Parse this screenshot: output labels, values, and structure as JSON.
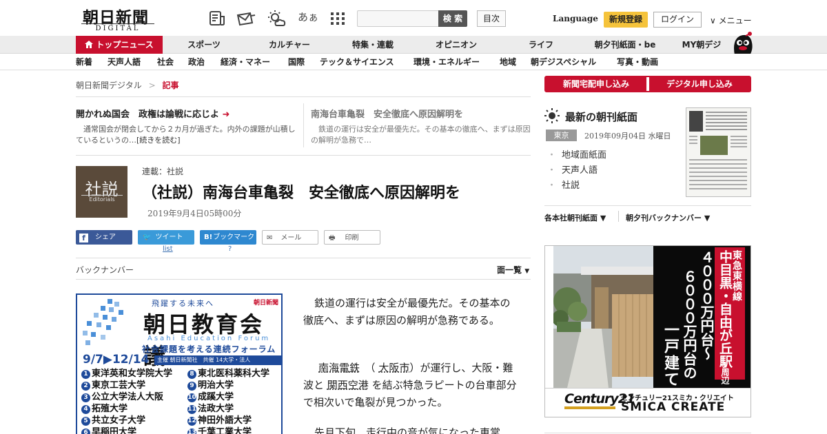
{
  "header": {
    "logo_main": "朝日新聞",
    "logo_sub": "DIGITAL",
    "icon_kana": "あぁ",
    "search_button": "検 索",
    "toc_button": "目次",
    "language": "Language",
    "signup": "新規登録",
    "login": "ログイン",
    "menu": "∨ メニュー"
  },
  "nav1": [
    "トップニュース",
    "スポーツ",
    "カルチャー",
    "特集・連載",
    "オピニオン",
    "ライフ",
    "朝夕刊紙面・be",
    "MY朝デジ"
  ],
  "nav2": [
    "新着",
    "天声人語",
    "社会",
    "政治",
    "経済・マネー",
    "国際",
    "テック＆サイエンス",
    "環境・エネルギー",
    "地域",
    "朝デジスペシャル",
    "写真・動画"
  ],
  "breadcrumb": {
    "home": "朝日新聞デジタル",
    "sep": ">",
    "current": "記事"
  },
  "related": [
    {
      "title": "開かれぬ国会　政権は論戦に応じよ",
      "body": "通常国会が閉会してから２カ月が過ぎた。内外の課題が山積しているというの…",
      "more": "[続きを読む]"
    },
    {
      "title": "南海台車亀裂　安全徹底へ原因解明を",
      "body": "鉄道の運行は安全が最優先だ。その基本の徹底へ、まずは原因の解明が急務で…"
    }
  ],
  "article": {
    "badge_main": "社説",
    "badge_sub": "Editorials",
    "series": "連載：社説",
    "title": "（社説）南海台車亀裂　安全徹底へ原因解明を",
    "date": "2019年9月4日05時00分",
    "share": {
      "facebook": "シェア",
      "tweet": "ツイート",
      "tweet_sub": "list",
      "hatena": "ブックマーク",
      "hatena_sub": "?",
      "mail": "メール",
      "print": "印刷"
    },
    "backnumber": "バックナンバー",
    "ichiran": "面一覧",
    "p1": "鉄道の運行は安全が最優先だ。その基本の徹底へ、まずは原因の解明が急務である。",
    "p2_a": "南海電鉄",
    "p2_b": "（",
    "p2_c": "大阪市",
    "p2_d": "）が運行し、大阪・難波と",
    "p2_e": "関西空港",
    "p2_f": "を結ぶ特急ラピートの台車部分で相次いで亀裂が見つかった。",
    "p3": "先月下旬、走行中の音が気になった車掌"
  },
  "ad_left": {
    "top": "飛躍する未来へ",
    "brand": "朝日新聞",
    "title": "朝日教育会議",
    "en": "Asahi Education Forum",
    "subtitle": "社会課題を考える連続フォーラム",
    "dates": "9/7▶12/14",
    "host": "主催 朝日新聞社　共催 14大学・法人",
    "left": [
      "東洋英和女学院大学",
      "東京工芸大学",
      "公立大学法人大阪",
      "拓殖大学",
      "共立女子大学",
      "早稲田大学"
    ],
    "left_nums": [
      "1",
      "2",
      "3",
      "4",
      "5",
      "6"
    ],
    "right": [
      "東北医科薬科大学",
      "明治大学",
      "成蹊大学",
      "法政大学",
      "神田外語大学",
      "千葉工業大学"
    ],
    "right_nums": [
      "8",
      "9",
      "10",
      "11",
      "12",
      "13"
    ]
  },
  "right": {
    "btn_delivery": "新聞宅配申し込み",
    "btn_digital": "デジタル申し込み",
    "chokan_title": "最新の朝刊紙面",
    "region": "東京",
    "paper_date": "2019年09月04日 水曜日",
    "list": [
      "地域面紙面",
      "天声人語",
      "社説"
    ],
    "sel1": "各本社朝刊紙面 ▼",
    "sel2": "朝夕刊バックナンバー ▼"
  },
  "ad_right": {
    "line1": "東急東横線",
    "line2": "中目黒・自由が丘駅",
    "line2b": "周辺",
    "price1": "４０００万円台～",
    "price2": "６０００万円台の",
    "house": "一戸建て",
    "logo": "Century21",
    "company_jp": "センチュリー21スミカ・クリエイト",
    "company_en": "SMICA CREATE"
  },
  "colors": {
    "accent": "#c8102e",
    "signup": "#f5c33b",
    "nav_bg": "#ececec",
    "ad_blue": "#1e4a9a"
  },
  "icons": [
    "news-icon",
    "mail-icon",
    "weather-icon",
    "font-size-icon",
    "grid-icon",
    "home-icon",
    "sun-icon",
    "arrow-right-icon"
  ]
}
